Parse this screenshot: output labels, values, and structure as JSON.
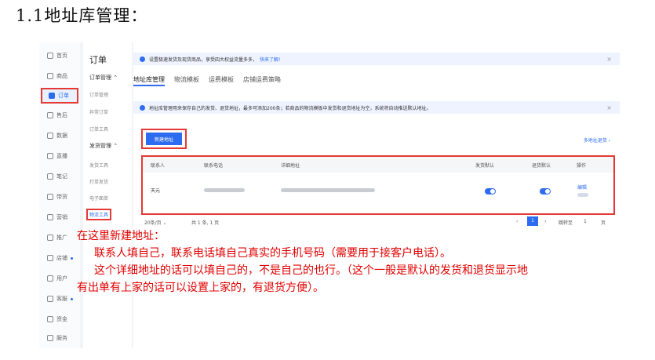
{
  "doc": {
    "heading": "1.1地址库管理："
  },
  "sidebar": {
    "items": [
      {
        "label": "首页"
      },
      {
        "label": "商品"
      },
      {
        "label": "订单"
      },
      {
        "label": "售后"
      },
      {
        "label": "数据"
      },
      {
        "label": "直播"
      },
      {
        "label": "笔记"
      },
      {
        "label": "带货"
      },
      {
        "label": "营销"
      },
      {
        "label": "推广"
      },
      {
        "label": "店铺"
      },
      {
        "label": "用户"
      },
      {
        "label": "客服"
      },
      {
        "label": "资金"
      },
      {
        "label": "服务"
      }
    ]
  },
  "subnav": {
    "title": "订单",
    "group1": "订单管理 ⌃",
    "group1_items": [
      "订单管理",
      "异常订单",
      "订单工具"
    ],
    "group2": "发货管理 ⌃",
    "group2_items": [
      "发货工具",
      "打单发货",
      "电子面单",
      "物流工具"
    ]
  },
  "banner": {
    "text": "设置极速发货及现货商品，享受四大权益流量多多，",
    "link": "快来了解!",
    "close": "×"
  },
  "tabs": [
    "地址库管理",
    "物流模板",
    "运费模板",
    "店铺运费策略"
  ],
  "notice": {
    "text": "地址库管理用来保存自己的发货、退货地址，最多可添加200条；若商品的物流模板中发货和退货地址为空，系统将自动推送默认地址。",
    "close": "×"
  },
  "toolbar": {
    "new_address": "新建地址",
    "multi_return": "多地址退货 ›"
  },
  "table": {
    "headers": [
      "联系人",
      "联系电话",
      "详细地址",
      "发货默认",
      "退货默认",
      "操作"
    ],
    "row": {
      "contact": "天元",
      "action": "编辑"
    }
  },
  "pager": {
    "page_size": "20条/页  ⌄",
    "total": "共 1 条, 1 页",
    "prev": "‹",
    "page": "1",
    "next": "›",
    "jump_label": "跳转至",
    "jump_value": "1",
    "page_unit": "页"
  },
  "annotation": {
    "line1": "在这里新建地址：",
    "line2": "联系人填自己，联系电话填自己真实的手机号码（需要用于接客户电话）。",
    "line3": "这个详细地址的话可以填自己的，不是自己的也行。（这个一般是默认的发货和退货显示地",
    "line4": "有出单有上家的话可以设置上家的，有退货方便）。"
  }
}
